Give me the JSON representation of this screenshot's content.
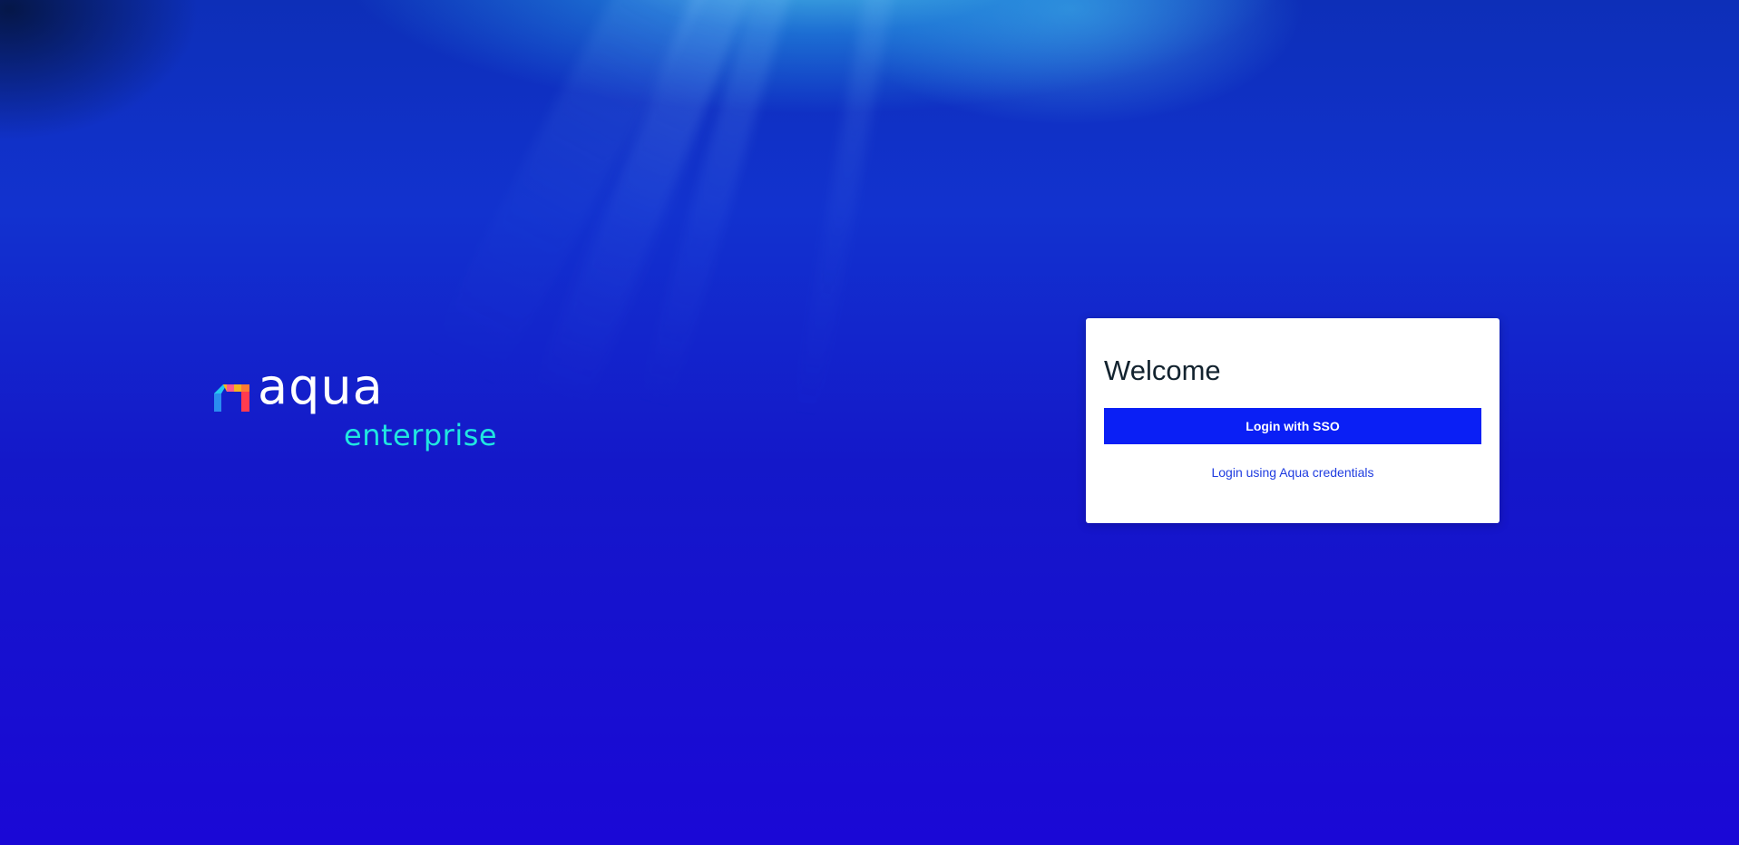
{
  "background": {
    "theme": "underwater",
    "primary_color": "#1418c9"
  },
  "logo": {
    "mark_icon": "aqua-logo-mark-icon",
    "word": "aqua",
    "subtitle": "enterprise",
    "word_color": "#ffffff",
    "subtitle_color": "#20e6e0"
  },
  "login_card": {
    "title": "Welcome",
    "sso_button_label": "Login with SSO",
    "sso_button_color": "#0a1ff5",
    "credentials_link_label": "Login using Aqua credentials",
    "credentials_link_color": "#1f3ce0"
  }
}
